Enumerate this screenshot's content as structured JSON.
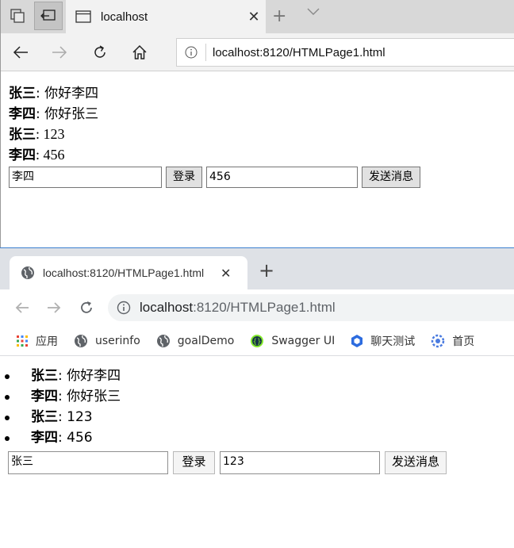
{
  "edge": {
    "tab_title": "localhost",
    "url": "localhost:8120/HTMLPage1.html",
    "messages": [
      {
        "sender": "张三",
        "text": ": 你好李四"
      },
      {
        "sender": "李四",
        "text": ": 你好张三"
      },
      {
        "sender": "张三",
        "text": ": 123"
      },
      {
        "sender": "李四",
        "text": ": 456"
      }
    ],
    "form": {
      "username_value": "李四",
      "login_label": "登录",
      "message_value": "456",
      "send_label": "发送消息"
    }
  },
  "chrome": {
    "tab_title": "localhost:8120/HTMLPage1.html",
    "url_host": "localhost",
    "url_rest": ":8120/HTMLPage1.html",
    "bookmarks": [
      {
        "label": "应用",
        "icon": "apps-grid-icon"
      },
      {
        "label": "userinfo",
        "icon": "globe-icon"
      },
      {
        "label": "goalDemo",
        "icon": "globe-icon"
      },
      {
        "label": "Swagger UI",
        "icon": "swagger-icon"
      },
      {
        "label": "聊天测试",
        "icon": "shield-hex-icon"
      },
      {
        "label": "首页",
        "icon": "gear-blue-icon"
      }
    ],
    "messages": [
      {
        "sender": "张三",
        "text": ": 你好李四"
      },
      {
        "sender": "李四",
        "text": ": 你好张三"
      },
      {
        "sender": "张三",
        "text": ": 123"
      },
      {
        "sender": "李四",
        "text": ": 456"
      }
    ],
    "form": {
      "username_value": "张三",
      "login_label": "登录",
      "message_value": "123",
      "send_label": "发送消息"
    }
  },
  "colors": {
    "edge_tabbar": "#d8d8d8",
    "chrome_tabbar": "#dee1e6",
    "window_divider": "#3c7fd0"
  }
}
